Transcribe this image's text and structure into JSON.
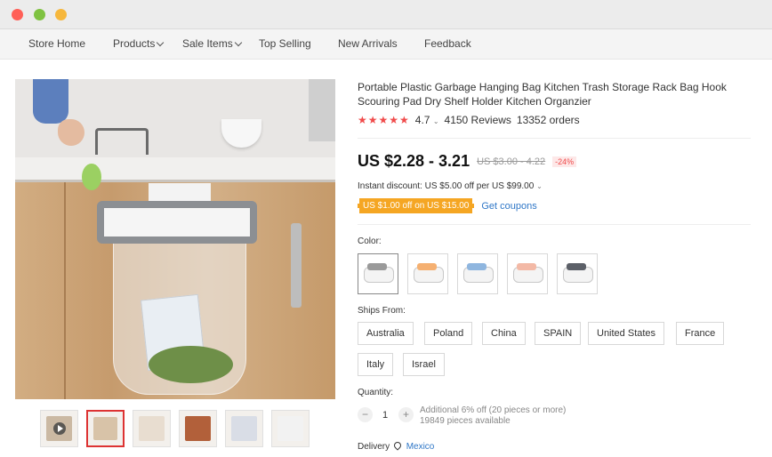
{
  "nav": {
    "items": [
      {
        "label": "Store Home",
        "dropdown": false
      },
      {
        "label": "Products",
        "dropdown": true
      },
      {
        "label": "Sale Items",
        "dropdown": true
      },
      {
        "label": "Top Selling",
        "dropdown": false
      },
      {
        "label": "New Arrivals",
        "dropdown": false
      },
      {
        "label": "Feedback",
        "dropdown": false
      }
    ]
  },
  "product": {
    "title": "Portable Plastic Garbage Hanging Bag Kitchen Trash Storage Rack Bag Hook Scouring Pad Dry Shelf Holder Kitchen Organzier",
    "stars": "★★★★★",
    "rating": "4.7",
    "reviews": "4150 Reviews",
    "orders": "13352 orders",
    "price": "US $2.28 - 3.21",
    "old_price": "US $3.00 - 4.22",
    "discount": "-24%",
    "instant_discount": "Instant discount: US $5.00 off per US $99.00",
    "coupon_badge": "US $1.00 off on US $15.00",
    "get_coupons": "Get coupons"
  },
  "options": {
    "color_label": "Color:",
    "colors": [
      "gray",
      "orange",
      "blue",
      "pink",
      "dark-gray"
    ],
    "ships_label": "Ships From:",
    "ships_from": [
      "Australia",
      "Poland",
      "China",
      "SPAIN",
      "United States",
      "France",
      "Italy",
      "Israel"
    ],
    "quantity_label": "Quantity:",
    "quantity": "1",
    "qty_note_1": "Additional 6% off (20 pieces or more)",
    "qty_note_2": "19849 pieces available",
    "delivery_label": "Delivery",
    "delivery_location": "Mexico"
  },
  "colors": {
    "accent_red": "#f04b4b",
    "coupon_orange": "#f5a623",
    "link_blue": "#2f77c7"
  }
}
